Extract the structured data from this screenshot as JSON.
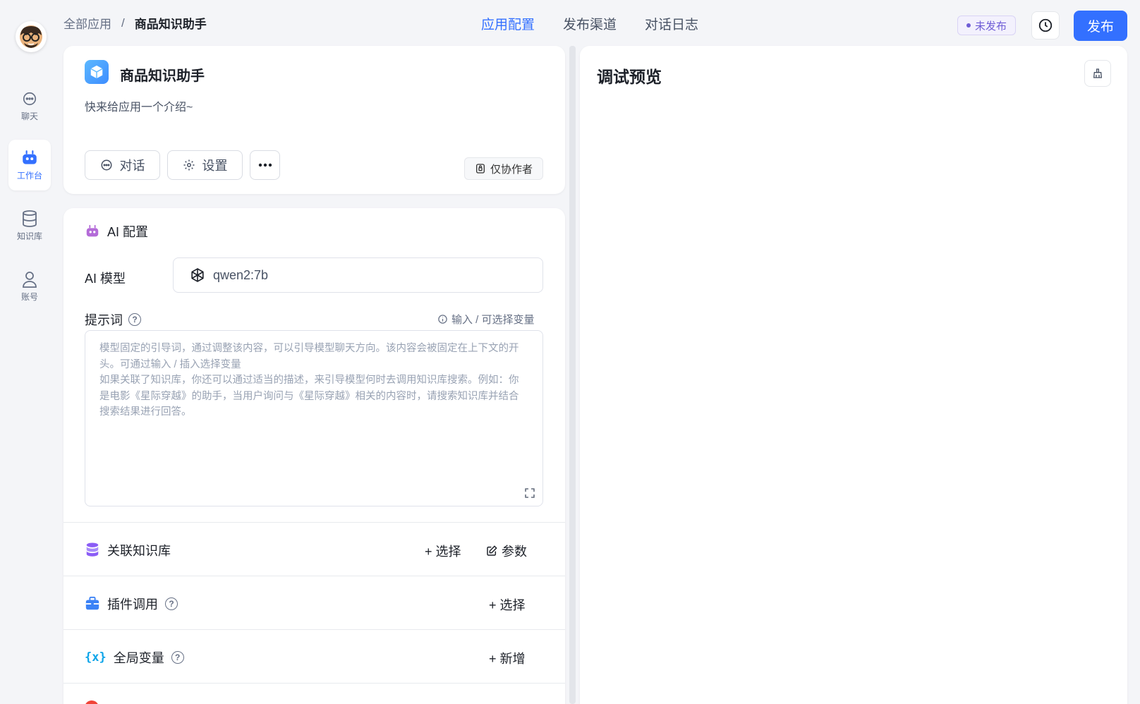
{
  "nav": {
    "items": [
      {
        "label": "聊天",
        "icon": "chat-icon"
      },
      {
        "label": "工作台",
        "icon": "robot-icon"
      },
      {
        "label": "知识库",
        "icon": "database-icon"
      },
      {
        "label": "账号",
        "icon": "user-icon"
      }
    ],
    "active_index": 1
  },
  "breadcrumb": {
    "root": "全部应用",
    "separator": "/",
    "current": "商品知识助手"
  },
  "tabs": [
    {
      "label": "应用配置",
      "active": true
    },
    {
      "label": "发布渠道",
      "active": false
    },
    {
      "label": "对话日志",
      "active": false
    }
  ],
  "header": {
    "status": "未发布",
    "publish_label": "发布",
    "history_icon": "clock-icon"
  },
  "app": {
    "name": "商品知识助手",
    "intro": "快来给应用一个介绍~",
    "chat_label": "对话",
    "settings_label": "设置",
    "collab_label": "仅协作者"
  },
  "config": {
    "title": "AI 配置",
    "model_label": "AI 模型",
    "model_value": "qwen2:7b",
    "prompt_label": "提示词",
    "prompt_hint": "输入 / 可选择变量",
    "prompt_placeholder_1": "模型固定的引导词，通过调整该内容，可以引导模型聊天方向。该内容会被固定在上下文的开头。可通过输入 / 插入选择变量",
    "prompt_placeholder_2": "如果关联了知识库，你还可以通过适当的描述，来引导模型何时去调用知识库搜索。例如：你是电影《星际穿越》的助手，当用户询问与《星际穿越》相关的内容时，请搜索知识库并结合搜索结果进行回答。",
    "kb_label": "关联知识库",
    "kb_select": "+ 选择",
    "kb_params": "参数",
    "plugin_label": "插件调用",
    "plugin_select": "+ 选择",
    "vars_label": "全局变量",
    "vars_add": "+ 新增"
  },
  "preview": {
    "title": "调试预览"
  },
  "colors": {
    "accent": "#3370ff",
    "status": "#6f5dd6"
  }
}
